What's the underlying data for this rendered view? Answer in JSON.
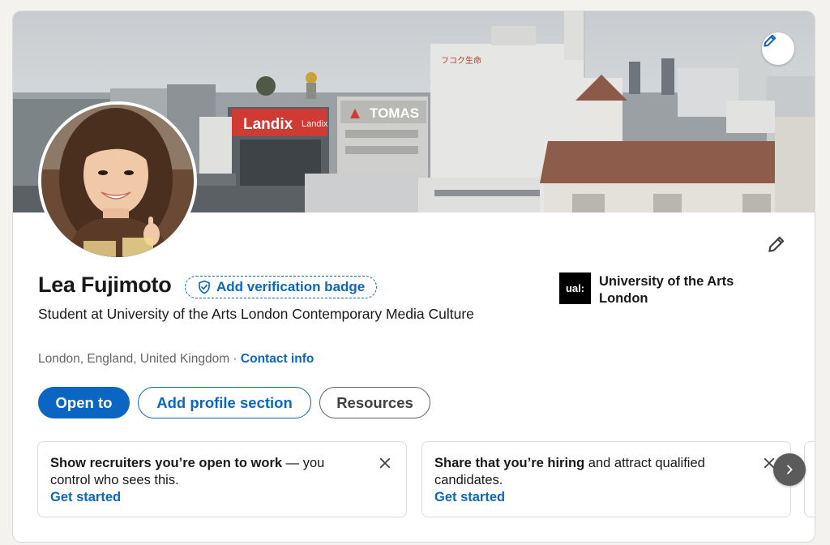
{
  "profile": {
    "name": "Lea Fujimoto",
    "verification_label": "Add verification badge",
    "headline": "Student at University of the Arts London Contemporary Media Culture",
    "location": "London, England, United Kingdom",
    "separator": "·",
    "contact_label": "Contact info"
  },
  "cover": {
    "signs": {
      "landix_main": "Landix",
      "landix_side": "Landix",
      "tomas": "TOMAS",
      "jp_sign": "フコク生命"
    }
  },
  "school": {
    "logo_text": "ual:",
    "name": "University of the Arts London"
  },
  "actions": {
    "open_to": "Open to",
    "add_section": "Add profile section",
    "resources": "Resources"
  },
  "suggestions": [
    {
      "bold": "Show recruiters you’re open to work",
      "rest": " — you control who sees this.",
      "cta": "Get started"
    },
    {
      "bold": "Share that you’re hiring",
      "rest": " and attract qualified candidates.",
      "cta": "Get started"
    }
  ],
  "icons": {
    "cover_edit": "pencil-icon",
    "intro_edit": "pencil-icon",
    "verify": "shield-check-icon",
    "close": "close-icon",
    "next": "chevron-right-icon"
  },
  "colors": {
    "brand_blue": "#0a66c2",
    "page_bg": "#f4f2ee",
    "text": "#191919",
    "muted": "#666666"
  }
}
